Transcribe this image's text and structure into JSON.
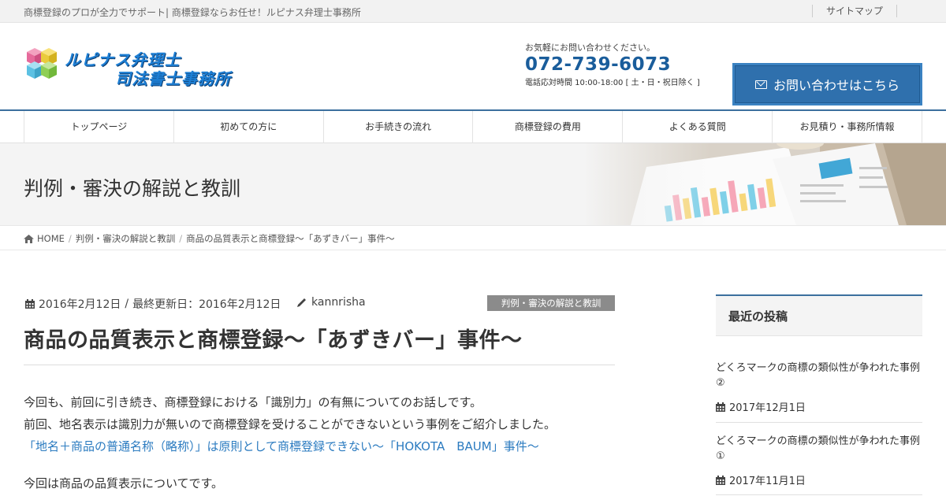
{
  "topbar": {
    "tagline": "商標登録のプロが全力でサポート| 商標登録ならお任せ！ルピナス弁理士事務所",
    "sitemap": "サイトマップ"
  },
  "header": {
    "logo_line1": "ルピナス弁理士",
    "logo_line2": "司法書士事務所",
    "contact_lead": "お気軽にお問い合わせください。",
    "phone": "072-739-6073",
    "hours": "電話応対時間 10:00-18:00 [ 土・日・祝日除く ]",
    "cta_label": "お問い合わせはこちら",
    "cta_icon": "envelope-icon"
  },
  "nav": {
    "items": [
      "トップページ",
      "初めての方に",
      "お手続きの流れ",
      "商標登録の費用",
      "よくある質問",
      "お見積り・事務所情報"
    ]
  },
  "banner": {
    "title": "判例・審決の解説と教訓"
  },
  "breadcrumb": {
    "home": "HOME",
    "category": "判例・審決の解説と教訓",
    "current": "商品の品質表示と商標登録～「あずきバー」事件～"
  },
  "post": {
    "date": "2016年2月12日",
    "updated": "最終更新日：2016年2月12日",
    "author": "kannrisha",
    "category_badge": "判例・審決の解説と教訓",
    "title": "商品の品質表示と商標登録～「あずきバー」事件～",
    "para1_line1": "今回も、前回に引き続き、商標登録における「識別力」の有無についてのお話しです。",
    "para1_line2": "前回、地名表示は識別力が無いので商標登録を受けることができないという事例をご紹介しました。",
    "link": "「地名＋商品の普通名称（略称）」は原則として商標登録できない～「HOKOTA　BAUM」事件～",
    "para2": "今回は商品の品質表示についてです。"
  },
  "sidebar": {
    "heading": "最近の投稿",
    "posts": [
      {
        "title": "どくろマークの商標の類似性が争われた事例②",
        "date": "2017年12月1日"
      },
      {
        "title": "どくろマークの商標の類似性が争われた事例①",
        "date": "2017年11月1日"
      }
    ]
  },
  "colors": {
    "accent": "#3b6f9e",
    "phone": "#1a5d9b",
    "cta": "#2f70ad",
    "link": "#2b7bc0",
    "badge": "#8b8b8b"
  }
}
